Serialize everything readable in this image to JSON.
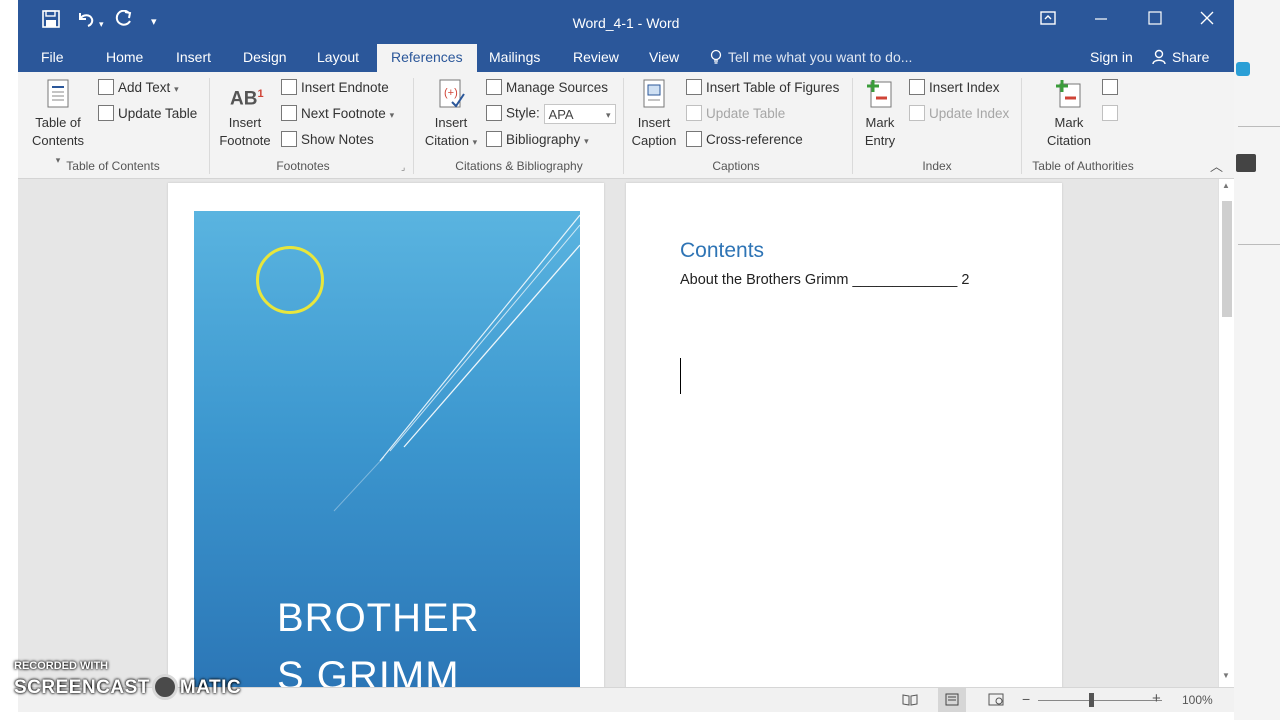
{
  "window": {
    "title": "Word_4-1 - Word",
    "quick_access": {
      "save_icon": "save-icon",
      "undo_icon": "undo-icon",
      "redo_icon": "redo-icon",
      "customize_icon": "customize-qat-icon"
    },
    "controls": {
      "ribbon_options": "ribbon-display-options-icon",
      "minimize": "minimize-icon",
      "maximize": "maximize-icon",
      "close": "close-icon"
    }
  },
  "tabs": {
    "file": "File",
    "home": "Home",
    "insert": "Insert",
    "design": "Design",
    "layout": "Layout",
    "references": "References",
    "mailings": "Mailings",
    "review": "Review",
    "view": "View",
    "tell_me": "Tell me what you want to do...",
    "sign_in": "Sign in",
    "share": "Share"
  },
  "ribbon": {
    "toc": {
      "button_line1": "Table of",
      "button_line2": "Contents",
      "add_text": "Add Text",
      "update_table": "Update Table",
      "group": "Table of Contents"
    },
    "footnotes": {
      "insert_line1": "Insert",
      "insert_line2": "Footnote",
      "insert_endnote": "Insert Endnote",
      "next_footnote": "Next Footnote",
      "show_notes": "Show Notes",
      "group": "Footnotes",
      "icon_text": "AB",
      "icon_super": "1"
    },
    "citations": {
      "insert_line1": "Insert",
      "insert_line2": "Citation",
      "manage_sources": "Manage Sources",
      "style_label": "Style:",
      "style_value": "APA",
      "bibliography": "Bibliography",
      "group": "Citations & Bibliography"
    },
    "captions": {
      "insert_line1": "Insert",
      "insert_line2": "Caption",
      "insert_tof": "Insert Table of Figures",
      "update_table": "Update Table",
      "cross_reference": "Cross-reference",
      "group": "Captions"
    },
    "index": {
      "mark_line1": "Mark",
      "mark_line2": "Entry",
      "insert_index": "Insert Index",
      "update_index": "Update Index",
      "group": "Index"
    },
    "authorities": {
      "mark_line1": "Mark",
      "mark_line2": "Citation",
      "group": "Table of Authorities"
    }
  },
  "document": {
    "cover_title_line1": "BROTHER",
    "cover_title_line2": "S GRIMM",
    "contents_heading": "Contents",
    "toc_entry": "About the Brothers Grimm",
    "toc_leader": "_____________",
    "toc_page": "2"
  },
  "status": {
    "zoom": "100%"
  },
  "watermark": {
    "line1": "RECORDED WITH",
    "line2a": "SCREENCAST",
    "line2b": "MATIC"
  },
  "colors": {
    "title_bar": "#2b579a",
    "cover_gradient_top": "#5ab4e0",
    "cover_gradient_bottom": "#2a73b4",
    "heading": "#2e74b5",
    "cursor_ring": "#e8e63c"
  }
}
